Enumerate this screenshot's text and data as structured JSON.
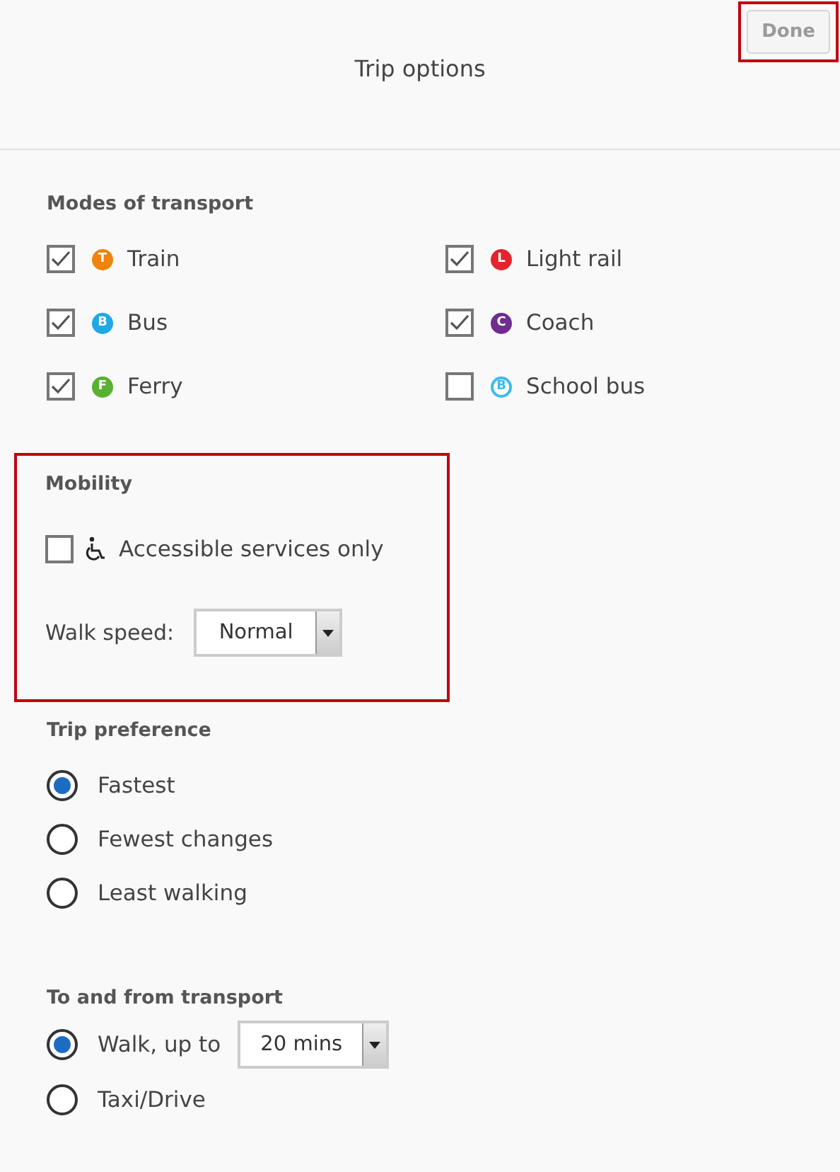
{
  "header": {
    "title": "Trip options",
    "done_button": {
      "label": "Done",
      "disabled": true,
      "highlighted": true
    }
  },
  "modes": {
    "heading": "Modes of transport",
    "items": [
      {
        "label": "Train",
        "badge": "T",
        "color": "#f0830a",
        "kind": "filled",
        "checked": true
      },
      {
        "label": "Light rail",
        "badge": "L",
        "color": "#e4242c",
        "kind": "filled",
        "checked": true
      },
      {
        "label": "Bus",
        "badge": "B",
        "color": "#1ea8e6",
        "kind": "filled",
        "checked": true
      },
      {
        "label": "Coach",
        "badge": "C",
        "color": "#6f2c91",
        "kind": "filled",
        "checked": true
      },
      {
        "label": "Ferry",
        "badge": "F",
        "color": "#5ab031",
        "kind": "filled",
        "checked": true
      },
      {
        "label": "School bus",
        "badge": "B",
        "color": "#3bbcec",
        "kind": "outlined",
        "checked": false
      }
    ]
  },
  "mobility": {
    "heading": "Mobility",
    "highlighted": true,
    "accessible": {
      "label": "Accessible services only",
      "checked": false
    },
    "walk_speed": {
      "label": "Walk speed:",
      "value": "Normal"
    }
  },
  "trip_preference": {
    "heading": "Trip preference",
    "options": [
      {
        "label": "Fastest",
        "selected": true
      },
      {
        "label": "Fewest changes",
        "selected": false
      },
      {
        "label": "Least walking",
        "selected": false
      }
    ]
  },
  "to_from_transport": {
    "heading": "To and from transport",
    "options": [
      {
        "label": "Walk, up to",
        "selected": true,
        "select_value": "20 mins"
      },
      {
        "label": "Taxi/Drive",
        "selected": false
      }
    ]
  }
}
